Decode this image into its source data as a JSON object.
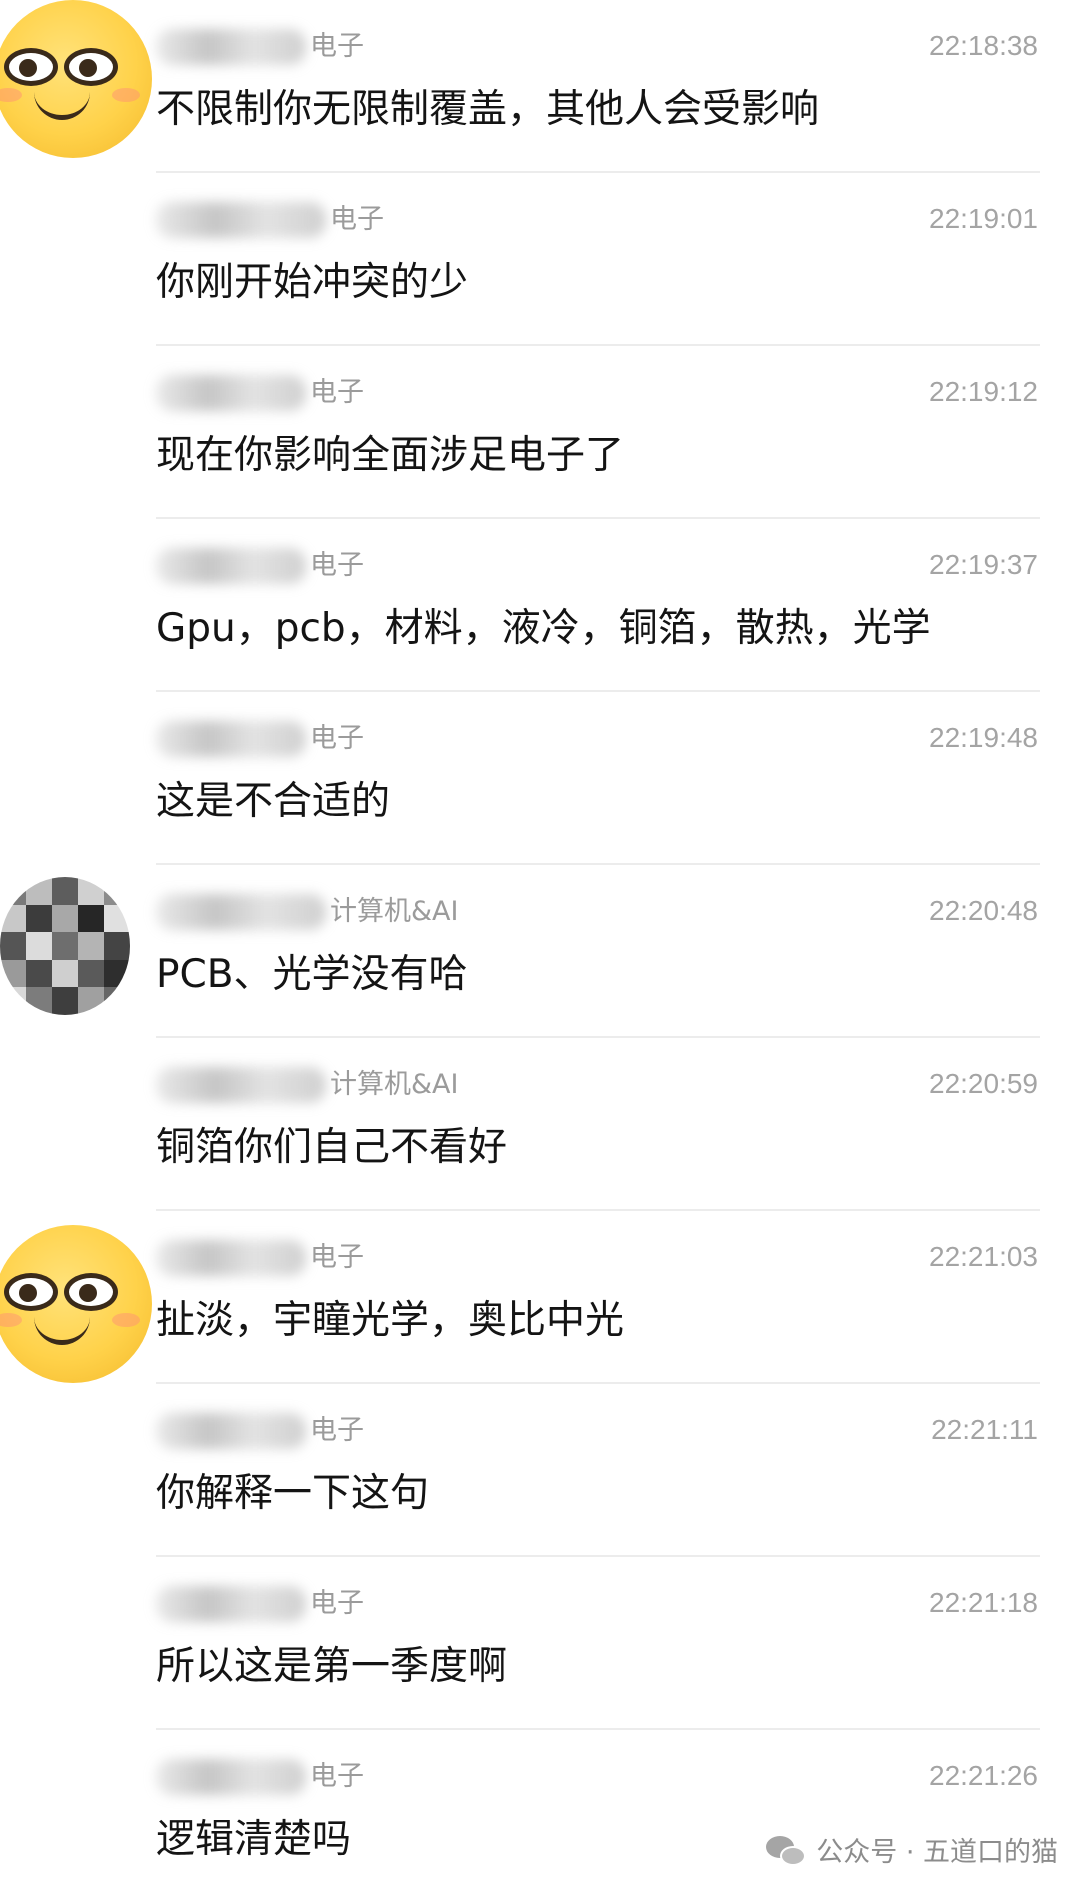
{
  "messages": [
    {
      "sender_tail": "电子",
      "time": "22:18:38",
      "text": "不限制你无限制覆盖，其他人会受影响",
      "avatar": "smiley-emoji"
    },
    {
      "sender_tail": "电子",
      "time": "22:19:01",
      "text": "你刚开始冲突的少"
    },
    {
      "sender_tail": "电子",
      "time": "22:19:12",
      "text": "现在你影响全面涉足电子了"
    },
    {
      "sender_tail": "电子",
      "time": "22:19:37",
      "text": "Gpu，pcb，材料，液冷，铜箔，散热，光学"
    },
    {
      "sender_tail": "电子",
      "time": "22:19:48",
      "text": "这是不合适的"
    },
    {
      "sender_tail": "计算机&AI",
      "time": "22:20:48",
      "text": "PCB、光学没有哈",
      "avatar": "pixelated-photo"
    },
    {
      "sender_tail": "计算机&AI",
      "time": "22:20:59",
      "text": "铜箔你们自己不看好"
    },
    {
      "sender_tail": "电子",
      "time": "22:21:03",
      "text": "扯淡，宇瞳光学，奥比中光",
      "avatar": "smiley-emoji"
    },
    {
      "sender_tail": "电子",
      "time": "22:21:11",
      "text": "你解释一下这句"
    },
    {
      "sender_tail": "电子",
      "time": "22:21:18",
      "text": "所以这是第一季度啊"
    },
    {
      "sender_tail": "电子",
      "time": "22:21:26",
      "text": "逻辑清楚吗"
    }
  ],
  "watermark": {
    "text": "公众号 · 五道口的猫",
    "icon": "wechat-icon"
  },
  "colors": {
    "timestamp": "#a4a4a4",
    "sender": "#9b9b9b",
    "message": "#141414",
    "separator": "#ececec"
  }
}
